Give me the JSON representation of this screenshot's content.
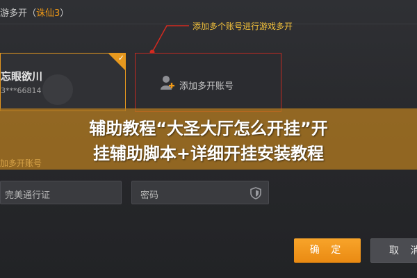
{
  "dialog": {
    "title_prefix": "游多开（",
    "title_highlight": "诛仙3",
    "title_suffix": "）"
  },
  "annotation": {
    "text": "添加多个账号进行游戏多开",
    "color": "#f3c13a",
    "line_color": "#d42a20"
  },
  "account_card": {
    "name": "忘眼欲川",
    "id_masked": "3***66814",
    "selected": true,
    "accent_color": "#e6981e"
  },
  "add_card": {
    "label": "添加多开账号",
    "icon": "add-user-icon"
  },
  "banner": {
    "line1": "辅助教程“大圣大厅怎么开挂”开",
    "line2": "挂辅助脚本+详细开挂安装教程",
    "partially_hidden_label": "加多开账号"
  },
  "form": {
    "account_placeholder": "完美通行证",
    "password_placeholder": "密码",
    "password_icon": "shield-icon"
  },
  "buttons": {
    "confirm_label": "确 定",
    "cancel_label": "取 消"
  }
}
